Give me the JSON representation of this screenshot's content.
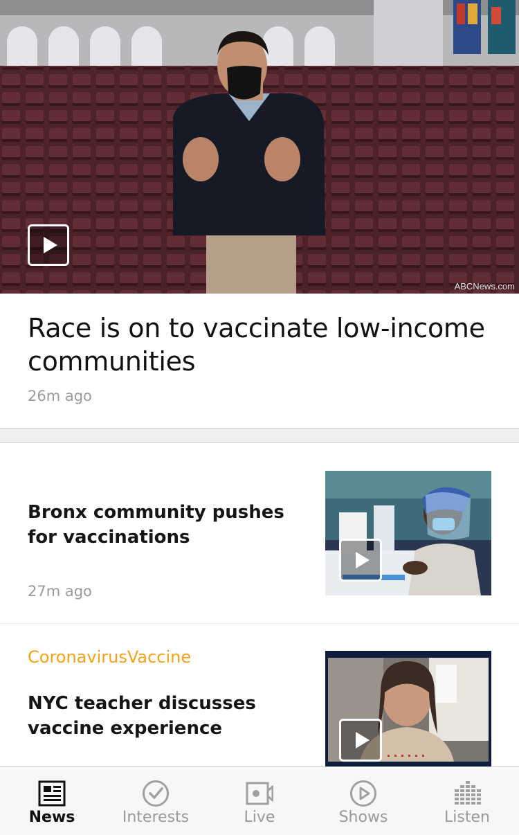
{
  "hero": {
    "image": "man-in-mask-in-empty-auditorium",
    "credit": "ABCNews.com",
    "title": "Race is on to vaccinate low-income communities",
    "time": "26m ago",
    "play_icon": "play-icon"
  },
  "stories": [
    {
      "category": "",
      "title": "Bronx community pushes for vaccinations",
      "time": "27m ago",
      "thumbnail": "healthcare-worker-with-face-shield"
    },
    {
      "category": "CoronavirusVaccine",
      "title": "NYC teacher discusses vaccine experience",
      "time": "",
      "thumbnail": "woman-video-call"
    }
  ],
  "tabbar": {
    "active": "News",
    "items": [
      {
        "label": "News",
        "icon": "newspaper-icon"
      },
      {
        "label": "Interests",
        "icon": "checkmark-circle-icon"
      },
      {
        "label": "Live",
        "icon": "video-camera-icon"
      },
      {
        "label": "Shows",
        "icon": "play-circle-icon"
      },
      {
        "label": "Listen",
        "icon": "equalizer-icon"
      }
    ]
  },
  "colors": {
    "category": "#f2a31c",
    "muted": "#9a9a9a",
    "text": "#111111"
  }
}
